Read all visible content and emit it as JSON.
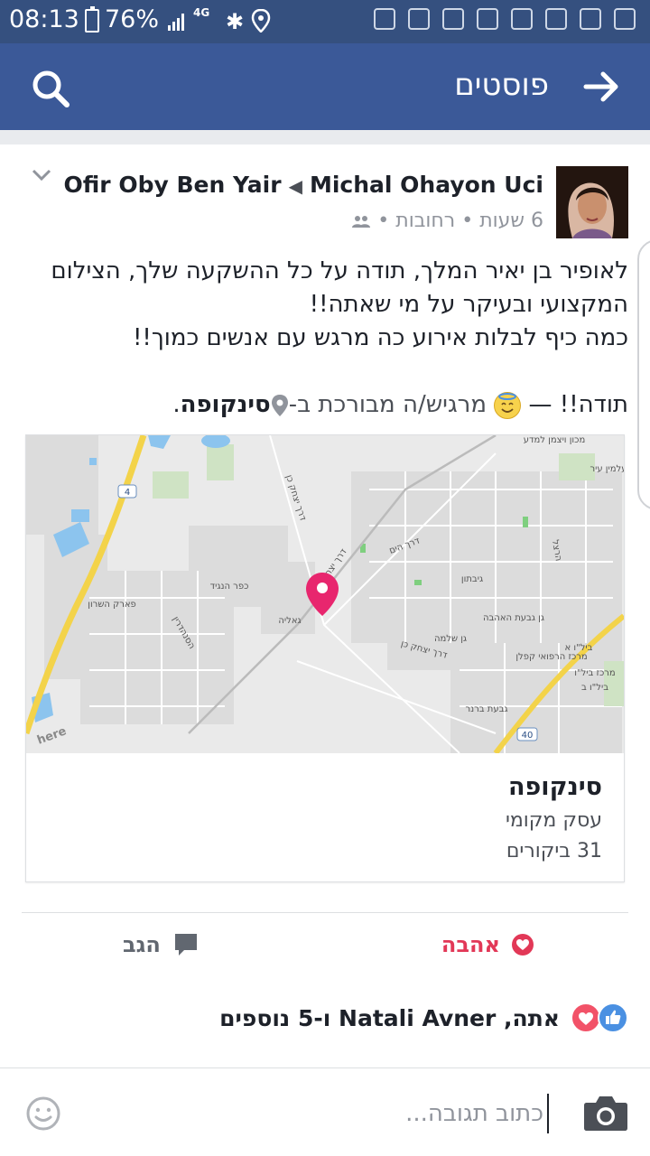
{
  "status_bar": {
    "time": "08:13",
    "battery": "76%",
    "network": "4G",
    "signal_letter": "R"
  },
  "app_bar": {
    "title": "פוסטים",
    "search_icon": "search-icon",
    "back_icon": "arrow-right-icon",
    "background": "#3b5998"
  },
  "post": {
    "author": "Michal Ohayon Uci",
    "target": "Ofir Oby Ben Yair",
    "time": "6 שעות",
    "location": "רחובות",
    "privacy_icon": "friends-icon",
    "text_lines": [
      "לאופיר בן יאיר המלך, תודה על כל ההשקעה שלך, הצילום",
      "המקצועי ובעיקר על מי שאתה!!",
      "כמה כיף לבלות אירוע כה מרגש עם אנשים כמוך!!"
    ],
    "feeling_prefix": "תודה!! —",
    "feeling": "מרגיש/ה מבורכת",
    "at": "ב-",
    "place": "סינקופה"
  },
  "map": {
    "roads": [
      "דרך יצחק כן",
      "דרך יצחק כן",
      "דרך יצחק כן",
      "דרך הים",
      "הסנהדרין"
    ],
    "places": [
      "גאליה",
      "כפר הנגיד",
      "גיבתון",
      "גן שלמה",
      "גבעת ברנר",
      "פארק השרון",
      "גן גבעת האהבה",
      "מרכז הרפואי קפלן",
      "ביל\"ו א",
      "ביל\"ו ב",
      "מרכז ביל\"ו",
      "עלמין עיר",
      "מכון ויצמן למדע",
      "הרצל"
    ],
    "road_numbers": [
      "4",
      "40"
    ],
    "brand": "here",
    "pin_color": "#e8266e"
  },
  "place_card": {
    "name": "סינקופה",
    "category": "עסק מקומי",
    "visits": "31 ביקורים"
  },
  "actions": {
    "love": "אהבה",
    "comment": "הגב",
    "love_color": "#e23857"
  },
  "reactions": {
    "text": "אתה, Natali Avner ו-5 נוספים"
  },
  "comment_box": {
    "placeholder": "כתוב תגובה..."
  }
}
